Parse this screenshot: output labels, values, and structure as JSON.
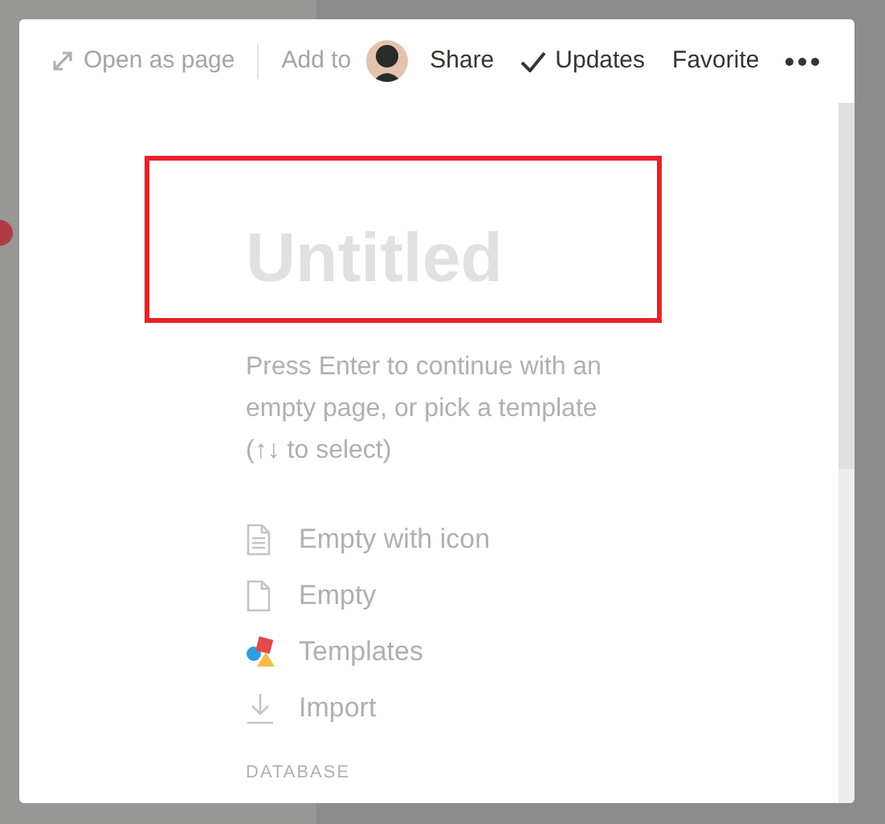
{
  "toolbar": {
    "open_as_page": "Open as page",
    "add_to": "Add to",
    "share": "Share",
    "updates": "Updates",
    "favorite": "Favorite"
  },
  "page": {
    "title_placeholder": "Untitled",
    "hint": "Press Enter to continue with an empty page, or pick a template (↑↓ to select)",
    "options": [
      {
        "kind": "doc-lines",
        "label": "Empty with icon"
      },
      {
        "kind": "doc",
        "label": "Empty"
      },
      {
        "kind": "shapes",
        "label": "Templates"
      },
      {
        "kind": "download",
        "label": "Import"
      }
    ],
    "section_heading": "DATABASE"
  }
}
